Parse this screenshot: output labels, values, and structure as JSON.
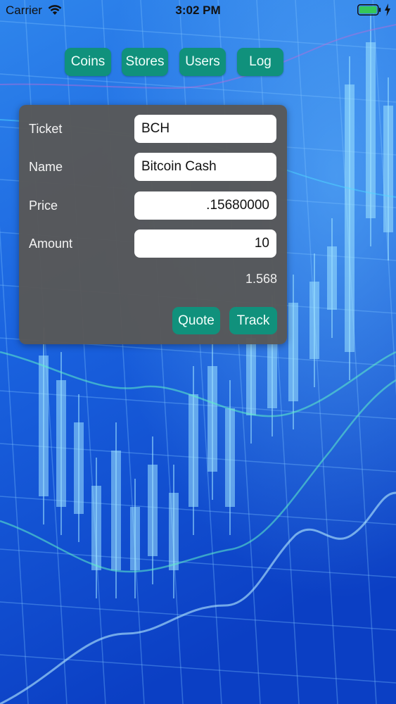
{
  "status_bar": {
    "carrier": "Carrier",
    "time": "3:02 PM",
    "icons": [
      "wifi-icon",
      "battery-icon",
      "charging-icon"
    ],
    "battery_color": "#34c759"
  },
  "nav": {
    "coins_label": "Coins",
    "stores_label": "Stores",
    "users_label": "Users",
    "log_label": "Log"
  },
  "form": {
    "ticket_label": "Ticket",
    "ticket_value": "BCH",
    "name_label": "Name",
    "name_value": "Bitcoin Cash",
    "price_label": "Price",
    "price_value": ".15680000",
    "amount_label": "Amount",
    "amount_value": "10",
    "total_value": "1.568",
    "quote_label": "Quote",
    "track_label": "Track"
  },
  "colors": {
    "accent": "#10917c",
    "panel": "#585858",
    "background": "#0d4fd6"
  }
}
